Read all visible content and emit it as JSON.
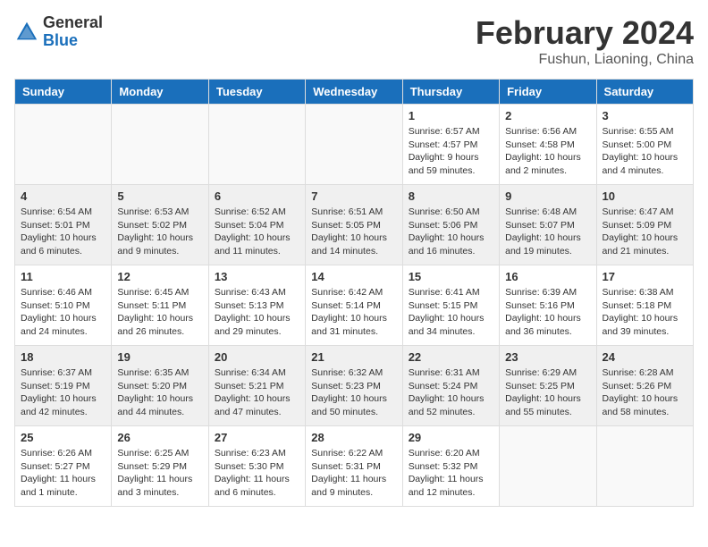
{
  "header": {
    "logo": {
      "general": "General",
      "blue": "Blue"
    },
    "title": "February 2024",
    "location": "Fushun, Liaoning, China"
  },
  "calendar": {
    "days_of_week": [
      "Sunday",
      "Monday",
      "Tuesday",
      "Wednesday",
      "Thursday",
      "Friday",
      "Saturday"
    ],
    "weeks": [
      {
        "shaded": false,
        "days": [
          {
            "num": "",
            "info": ""
          },
          {
            "num": "",
            "info": ""
          },
          {
            "num": "",
            "info": ""
          },
          {
            "num": "",
            "info": ""
          },
          {
            "num": "1",
            "info": "Sunrise: 6:57 AM\nSunset: 4:57 PM\nDaylight: 9 hours\nand 59 minutes."
          },
          {
            "num": "2",
            "info": "Sunrise: 6:56 AM\nSunset: 4:58 PM\nDaylight: 10 hours\nand 2 minutes."
          },
          {
            "num": "3",
            "info": "Sunrise: 6:55 AM\nSunset: 5:00 PM\nDaylight: 10 hours\nand 4 minutes."
          }
        ]
      },
      {
        "shaded": true,
        "days": [
          {
            "num": "4",
            "info": "Sunrise: 6:54 AM\nSunset: 5:01 PM\nDaylight: 10 hours\nand 6 minutes."
          },
          {
            "num": "5",
            "info": "Sunrise: 6:53 AM\nSunset: 5:02 PM\nDaylight: 10 hours\nand 9 minutes."
          },
          {
            "num": "6",
            "info": "Sunrise: 6:52 AM\nSunset: 5:04 PM\nDaylight: 10 hours\nand 11 minutes."
          },
          {
            "num": "7",
            "info": "Sunrise: 6:51 AM\nSunset: 5:05 PM\nDaylight: 10 hours\nand 14 minutes."
          },
          {
            "num": "8",
            "info": "Sunrise: 6:50 AM\nSunset: 5:06 PM\nDaylight: 10 hours\nand 16 minutes."
          },
          {
            "num": "9",
            "info": "Sunrise: 6:48 AM\nSunset: 5:07 PM\nDaylight: 10 hours\nand 19 minutes."
          },
          {
            "num": "10",
            "info": "Sunrise: 6:47 AM\nSunset: 5:09 PM\nDaylight: 10 hours\nand 21 minutes."
          }
        ]
      },
      {
        "shaded": false,
        "days": [
          {
            "num": "11",
            "info": "Sunrise: 6:46 AM\nSunset: 5:10 PM\nDaylight: 10 hours\nand 24 minutes."
          },
          {
            "num": "12",
            "info": "Sunrise: 6:45 AM\nSunset: 5:11 PM\nDaylight: 10 hours\nand 26 minutes."
          },
          {
            "num": "13",
            "info": "Sunrise: 6:43 AM\nSunset: 5:13 PM\nDaylight: 10 hours\nand 29 minutes."
          },
          {
            "num": "14",
            "info": "Sunrise: 6:42 AM\nSunset: 5:14 PM\nDaylight: 10 hours\nand 31 minutes."
          },
          {
            "num": "15",
            "info": "Sunrise: 6:41 AM\nSunset: 5:15 PM\nDaylight: 10 hours\nand 34 minutes."
          },
          {
            "num": "16",
            "info": "Sunrise: 6:39 AM\nSunset: 5:16 PM\nDaylight: 10 hours\nand 36 minutes."
          },
          {
            "num": "17",
            "info": "Sunrise: 6:38 AM\nSunset: 5:18 PM\nDaylight: 10 hours\nand 39 minutes."
          }
        ]
      },
      {
        "shaded": true,
        "days": [
          {
            "num": "18",
            "info": "Sunrise: 6:37 AM\nSunset: 5:19 PM\nDaylight: 10 hours\nand 42 minutes."
          },
          {
            "num": "19",
            "info": "Sunrise: 6:35 AM\nSunset: 5:20 PM\nDaylight: 10 hours\nand 44 minutes."
          },
          {
            "num": "20",
            "info": "Sunrise: 6:34 AM\nSunset: 5:21 PM\nDaylight: 10 hours\nand 47 minutes."
          },
          {
            "num": "21",
            "info": "Sunrise: 6:32 AM\nSunset: 5:23 PM\nDaylight: 10 hours\nand 50 minutes."
          },
          {
            "num": "22",
            "info": "Sunrise: 6:31 AM\nSunset: 5:24 PM\nDaylight: 10 hours\nand 52 minutes."
          },
          {
            "num": "23",
            "info": "Sunrise: 6:29 AM\nSunset: 5:25 PM\nDaylight: 10 hours\nand 55 minutes."
          },
          {
            "num": "24",
            "info": "Sunrise: 6:28 AM\nSunset: 5:26 PM\nDaylight: 10 hours\nand 58 minutes."
          }
        ]
      },
      {
        "shaded": false,
        "days": [
          {
            "num": "25",
            "info": "Sunrise: 6:26 AM\nSunset: 5:27 PM\nDaylight: 11 hours\nand 1 minute."
          },
          {
            "num": "26",
            "info": "Sunrise: 6:25 AM\nSunset: 5:29 PM\nDaylight: 11 hours\nand 3 minutes."
          },
          {
            "num": "27",
            "info": "Sunrise: 6:23 AM\nSunset: 5:30 PM\nDaylight: 11 hours\nand 6 minutes."
          },
          {
            "num": "28",
            "info": "Sunrise: 6:22 AM\nSunset: 5:31 PM\nDaylight: 11 hours\nand 9 minutes."
          },
          {
            "num": "29",
            "info": "Sunrise: 6:20 AM\nSunset: 5:32 PM\nDaylight: 11 hours\nand 12 minutes."
          },
          {
            "num": "",
            "info": ""
          },
          {
            "num": "",
            "info": ""
          }
        ]
      }
    ]
  }
}
